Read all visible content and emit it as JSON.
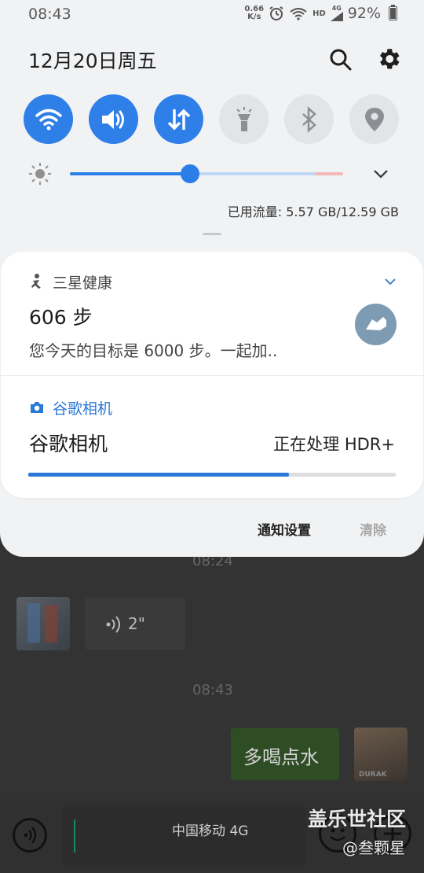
{
  "status_bar": {
    "time": "08:43",
    "net_speed_value": "0.66",
    "net_speed_unit": "K/s",
    "network_hd": "HD",
    "network_gen": "4G",
    "battery": "92%"
  },
  "header": {
    "date": "12月20日周五"
  },
  "quick_settings": [
    {
      "name": "wifi",
      "icon": "wifi-icon",
      "state": "on"
    },
    {
      "name": "sound",
      "icon": "volume-icon",
      "state": "on"
    },
    {
      "name": "mobile-data",
      "icon": "data-arrows-icon",
      "state": "on"
    },
    {
      "name": "flashlight",
      "icon": "flashlight-icon",
      "state": "off"
    },
    {
      "name": "bluetooth",
      "icon": "bluetooth-icon",
      "state": "off"
    },
    {
      "name": "location",
      "icon": "location-icon",
      "state": "off"
    }
  ],
  "brightness": {
    "level": 0.44
  },
  "data_usage": "已用流量: 5.57 GB/12.59 GB",
  "notifications": [
    {
      "app": "三星健康",
      "app_color": "#444444",
      "title": "606 步",
      "text": "您今天的目标是 6000 步。一起加.."
    },
    {
      "app": "谷歌相机",
      "app_color": "#2a78d7",
      "title": "谷歌相机",
      "status": "正在处理 HDR+",
      "progress": 0.71
    }
  ],
  "footer": {
    "settings": "通知设置",
    "clear": "清除"
  },
  "chat": {
    "time_top": "08:24",
    "voice_duration": "2\"",
    "time_mid": "08:43",
    "message": "多喝点水",
    "avatar_caption": "DURAK",
    "carrier": "中国移动 4G"
  },
  "watermark": {
    "site": "盖乐世社区",
    "user": "@叁颗星"
  },
  "colors": {
    "accent": "#2e7fe8",
    "shade_bg": "#f1f2f4"
  }
}
